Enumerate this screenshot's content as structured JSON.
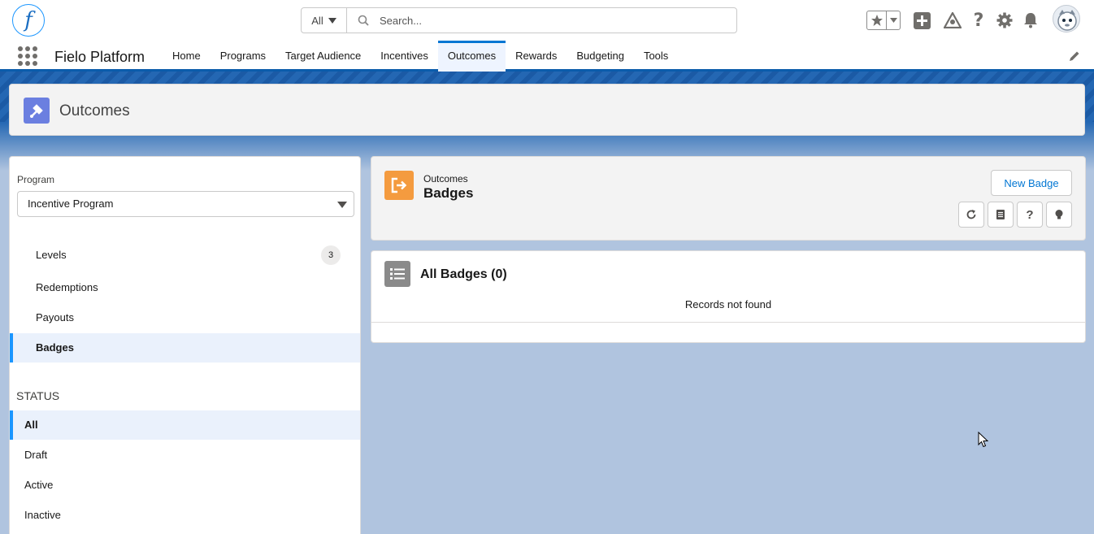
{
  "header": {
    "logo_letter": "f",
    "search_scope": "All",
    "search_placeholder": "Search...",
    "icons": [
      "favorites-star-icon",
      "add-icon",
      "trailhead-icon",
      "help-icon",
      "setup-gear-icon",
      "notifications-bell-icon",
      "user-avatar"
    ]
  },
  "nav": {
    "app_name": "Fielo Platform",
    "tabs": [
      {
        "label": "Home"
      },
      {
        "label": "Programs"
      },
      {
        "label": "Target Audience"
      },
      {
        "label": "Incentives"
      },
      {
        "label": "Outcomes"
      },
      {
        "label": "Rewards"
      },
      {
        "label": "Budgeting"
      },
      {
        "label": "Tools"
      }
    ],
    "active_tab": "Outcomes"
  },
  "page": {
    "title": "Outcomes"
  },
  "left_panel": {
    "program_label": "Program",
    "program_value": "Incentive Program",
    "items": [
      {
        "label": "Levels",
        "count": "3"
      },
      {
        "label": "Redemptions"
      },
      {
        "label": "Payouts"
      },
      {
        "label": "Badges"
      }
    ],
    "active_item": "Badges",
    "status_title": "STATUS",
    "statuses": [
      {
        "label": "All"
      },
      {
        "label": "Draft"
      },
      {
        "label": "Active"
      },
      {
        "label": "Inactive"
      }
    ],
    "active_status": "All"
  },
  "object_card": {
    "eyebrow": "Outcomes",
    "title": "Badges",
    "new_button": "New Badge",
    "action_icons": [
      "refresh-icon",
      "notes-icon",
      "help-icon",
      "tip-lightbulb-icon"
    ]
  },
  "list_card": {
    "title": "All Badges (0)",
    "empty_message": "Records not found"
  },
  "colors": {
    "brand_blue": "#0176d3",
    "page_icon": "#6b7fe0",
    "object_icon": "#f49b3f",
    "active_bg": "#eaf1fc"
  }
}
